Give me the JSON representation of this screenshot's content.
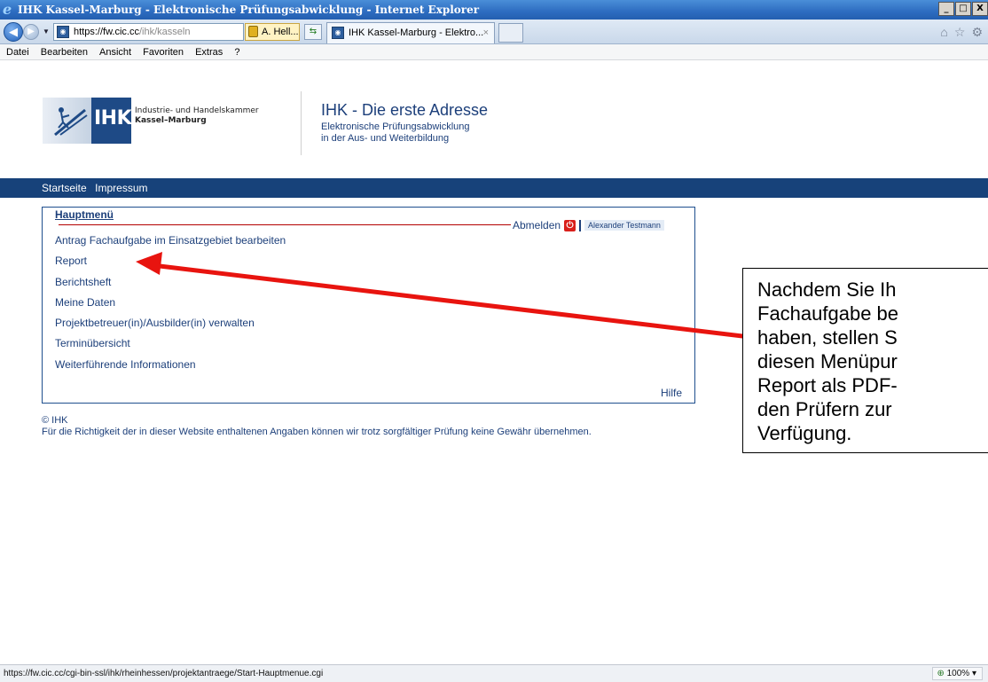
{
  "window": {
    "title": "IHK Kassel-Marburg - Elektronische Prüfungsabwicklung - Internet Explorer",
    "buttons": [
      "_",
      "□",
      "X"
    ]
  },
  "navbar": {
    "address_host": "https://fw.cic.cc",
    "address_path": "/ihk/kasseln",
    "cert_label": "A. Hell...",
    "tab_title": "IHK Kassel-Marburg - Elektro...",
    "tab_close": "×"
  },
  "menubar": {
    "items": [
      "Datei",
      "Bearbeiten",
      "Ansicht",
      "Favoriten",
      "Extras",
      "?"
    ]
  },
  "header": {
    "logo_mark": "IHK",
    "logo_line1": "Industrie- und Handelskammer",
    "logo_line2": "Kassel–Marburg",
    "title": "IHK - Die erste Adresse",
    "subtitle_line1": "Elektronische Prüfungsabwicklung",
    "subtitle_line2": "in der Aus- und Weiterbildung"
  },
  "topnav": {
    "items": [
      "Startseite",
      "Impressum"
    ]
  },
  "main_menu": {
    "title": "Hauptmenü",
    "logout": "Abmelden",
    "user": "Alexander Testmann",
    "items": [
      "Antrag Fachaufgabe im Einsatzgebiet bearbeiten",
      "Report",
      "Berichtsheft",
      "Meine Daten",
      "Projektbetreuer(in)/Ausbilder(in) verwalten",
      "Terminübersicht",
      "Weiterführende Informationen"
    ],
    "help": "Hilfe"
  },
  "footer": {
    "copyright": "© IHK",
    "disclaimer": "Für die Richtigkeit der in dieser Website enthaltenen Angaben können wir trotz sorgfältiger Prüfung keine Gewähr übernehmen."
  },
  "callout": {
    "lines": [
      "Nachdem Sie Ih",
      "Fachaufgabe be",
      "haben, stellen S",
      "diesen Menüpur",
      "Report als PDF-",
      "den Prüfern zur",
      "Verfügung."
    ],
    "arrow_color": "#e8140f"
  },
  "statusbar": {
    "url": "https://fw.cic.cc/cgi-bin-ssl/ihk/rheinhessen/projektantraege/Start-Hauptmenue.cgi",
    "zoom": "100%"
  }
}
